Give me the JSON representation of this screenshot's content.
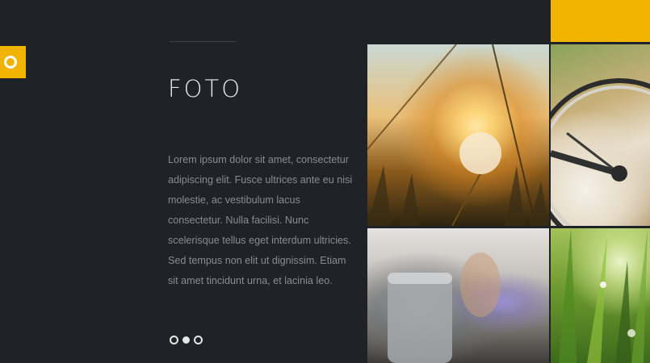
{
  "slide": {
    "title": "FOTO",
    "body": "Lorem ipsum dolor sit amet, consectetur adipiscing elit. Fusce ultrices ante eu nisi molestie, ac vestibulum lacus consectetur. Nulla facilisi. Nunc scelerisque tellus eget interdum ultricies. Sed tempus non elit ut dignissim. Etiam sit amet tincidunt urna, et lacinia leo.",
    "pager": {
      "total": 3,
      "active": 2
    }
  },
  "gallery": {
    "photos": [
      {
        "subject": "dandelion at sunset"
      },
      {
        "subject": "bicycle wheel"
      },
      {
        "subject": "blurred cup"
      },
      {
        "subject": "green grass"
      }
    ]
  },
  "colors": {
    "background": "#1f2226",
    "accent": "#f0b400",
    "title": "#e8e8e8",
    "body_text": "#878d94"
  },
  "icons": {
    "side_tab": "ring-icon"
  }
}
